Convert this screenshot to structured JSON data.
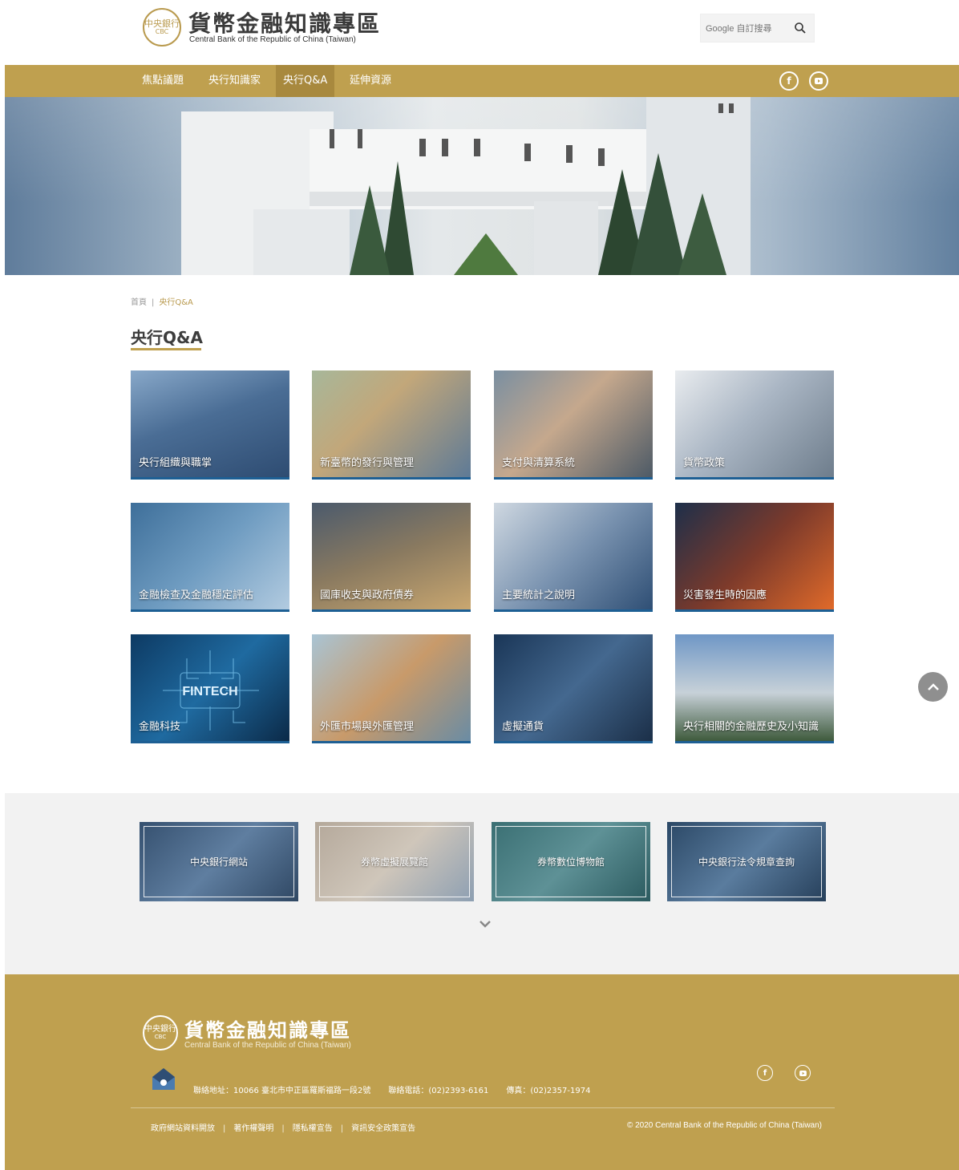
{
  "header": {
    "seal_top": "中央銀行",
    "seal_mid": "CBC",
    "title": "貨幣金融知識專區",
    "subtitle": "Central Bank of the Republic of China (Taiwan)",
    "search_placeholder": "Google 自訂搜尋"
  },
  "nav": {
    "items": [
      "焦點議題",
      "央行知識家",
      "央行Q&A",
      "延伸資源"
    ],
    "active_index": 2,
    "social": [
      "facebook",
      "youtube"
    ]
  },
  "breadcrumb": {
    "home": "首頁",
    "sep": "|",
    "current": "央行Q&A"
  },
  "page_title": "央行Q&A",
  "cards": [
    "央行組織與職掌",
    "新臺幣的發行與管理",
    "支付與清算系統",
    "貨幣政策",
    "金融檢查及金融穩定評估",
    "國庫收支與政府債券",
    "主要統計之說明",
    "災害發生時的因應",
    "金融科技",
    "外匯市場與外匯管理",
    "虛擬通貨",
    "央行相關的金融歷史及小知識"
  ],
  "links": [
    "中央銀行網站",
    "券幣虛擬展覽館",
    "券幣數位博物館",
    "中央銀行法令規章查詢"
  ],
  "footer": {
    "seal_top": "中央銀行",
    "seal_mid": "CBC",
    "title": "貨幣金融知識專區",
    "subtitle": "Central Bank of the Republic of China (Taiwan)",
    "address": "聯絡地址：10066 臺北市中正區羅斯福路一段2號",
    "phone": "聯絡電話：(02)2393-6161",
    "fax": "傳真：(02)2357-1974",
    "links": [
      "政府網站資料開放",
      "著作權聲明",
      "隱私權宣告",
      "資訊安全政策宣告"
    ],
    "copyright": "© 2020 Central Bank of the Republic of China (Taiwan)"
  },
  "colors": {
    "brand_gold": "#bfa04f",
    "card_accent": "#1d5f94"
  }
}
